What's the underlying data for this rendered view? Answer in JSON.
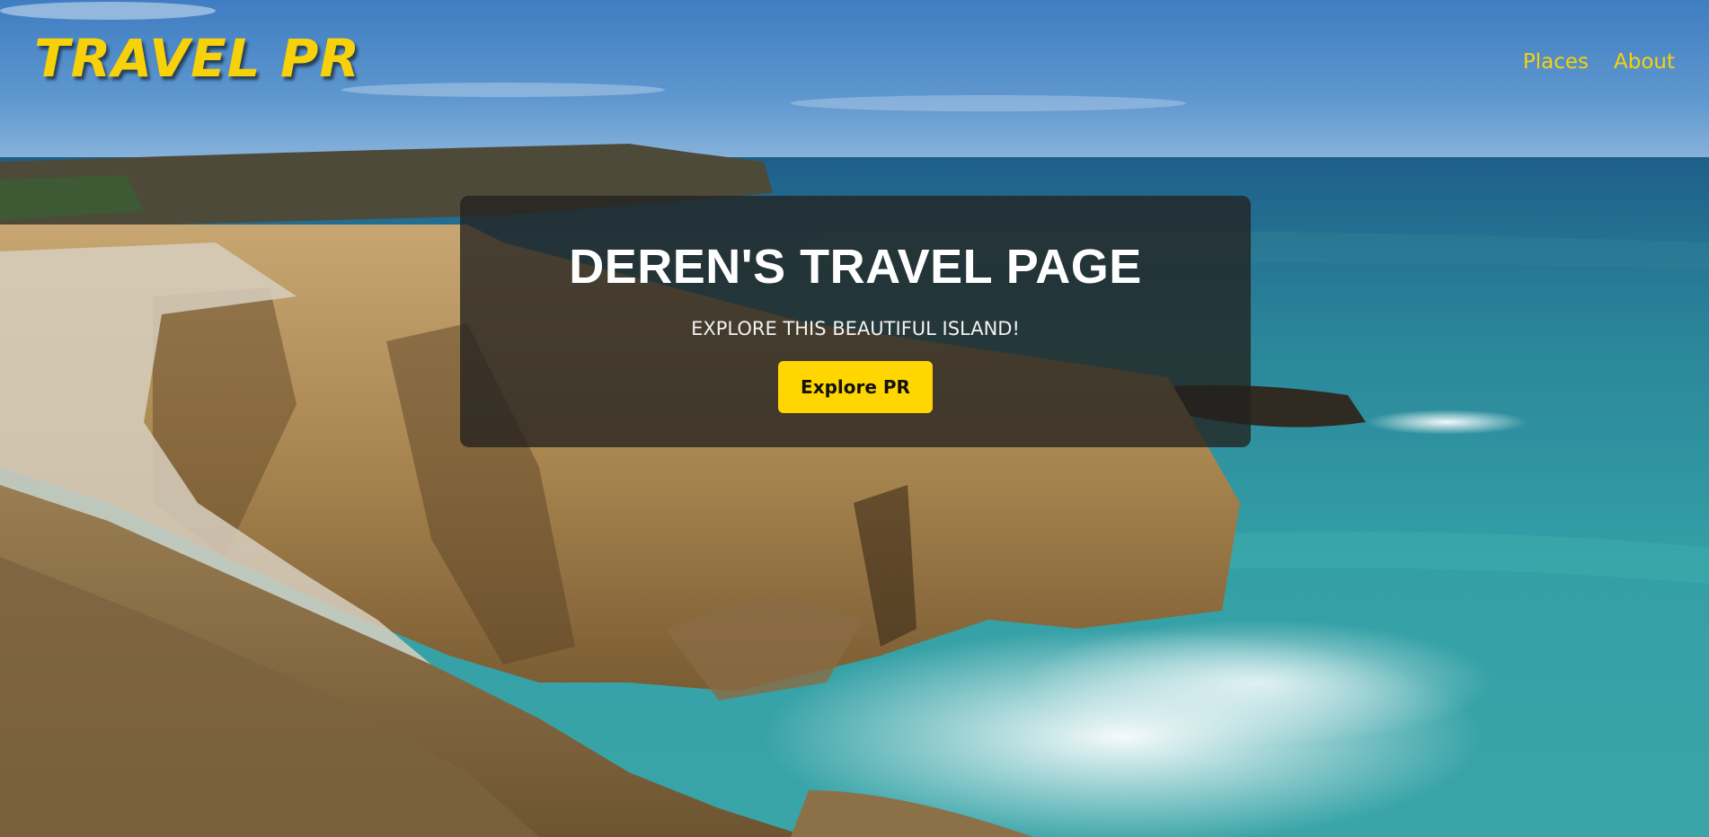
{
  "navbar": {
    "brand": "TRAVEL PR",
    "links": [
      {
        "label": "Places"
      },
      {
        "label": "About"
      }
    ]
  },
  "hero": {
    "title": "DEREN'S TRAVEL PAGE",
    "subtitle": "EXPLORE THIS BEAUTIFUL ISLAND!",
    "cta_label": "Explore PR"
  },
  "colors": {
    "brand_yellow": "#f7d20a",
    "button_yellow": "#ffd600",
    "overlay": "#23211f"
  }
}
